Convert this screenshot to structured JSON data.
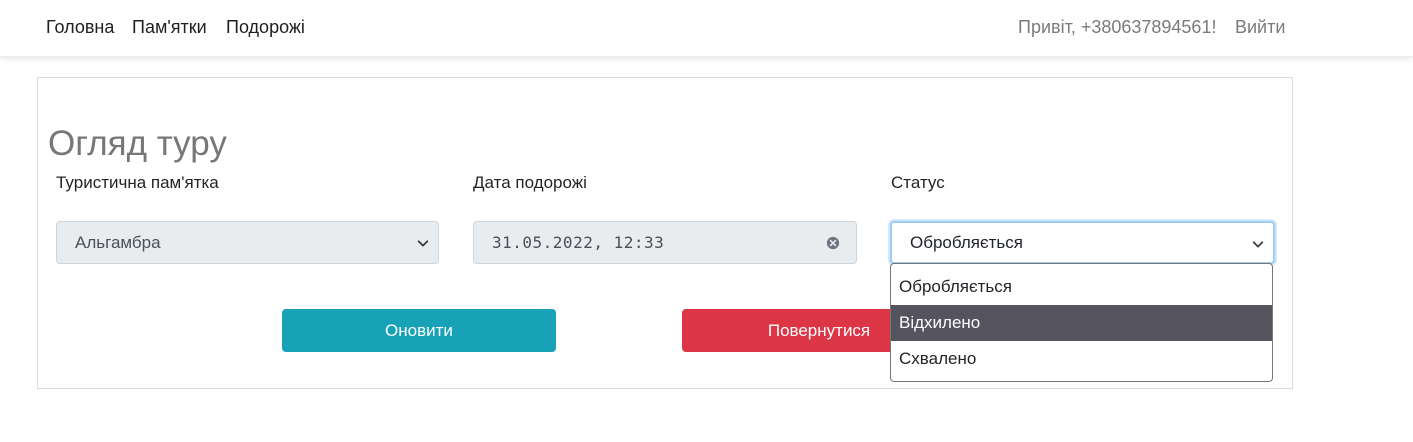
{
  "navbar": {
    "links": [
      "Головна",
      "Пам'ятки",
      "Подорожі"
    ],
    "greeting": "Привіт, +380637894561!",
    "logout": "Вийти"
  },
  "page": {
    "title": "Огляд туру"
  },
  "form": {
    "attraction": {
      "label": "Туристична пам'ятка",
      "value": "Альгамбра",
      "icon": "chevron-down-icon"
    },
    "date": {
      "label": "Дата подорожі",
      "value": "31.05.2022, 12:33",
      "icon": "clear-icon"
    },
    "status": {
      "label": "Статус",
      "value": "Обробляється",
      "icon": "chevron-down-icon",
      "options": [
        "Обробляється",
        "Відхилено",
        "Схвалено"
      ],
      "highlighted_option": "Відхилено"
    }
  },
  "buttons": {
    "update": "Оновити",
    "back": "Повернутися"
  },
  "colors": {
    "update_button": "#17a2b8",
    "back_button": "#dc3545",
    "dropdown_highlight": "#55545e",
    "focus_border": "#9ccdf3"
  }
}
